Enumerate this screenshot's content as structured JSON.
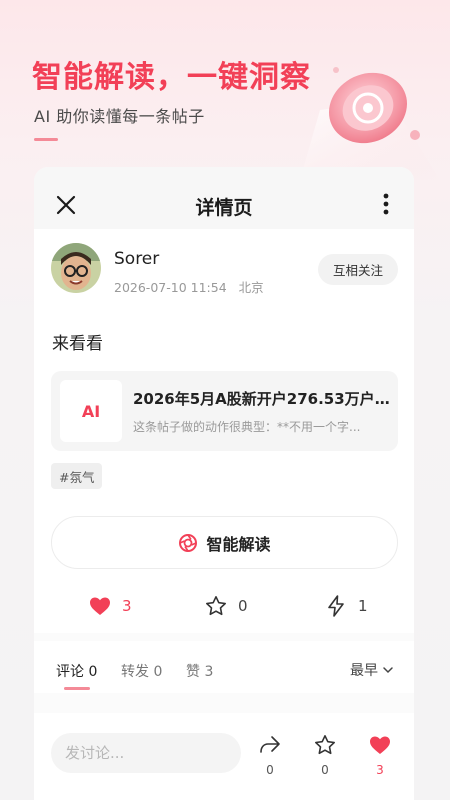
{
  "hero": {
    "title": "智能解读，一键洞察",
    "subtitle": "AI 助你读懂每一条帖子"
  },
  "header": {
    "title": "详情页"
  },
  "post": {
    "author": {
      "name": "Sorer",
      "timestamp": "2026-07-10 11:54",
      "location": "北京"
    },
    "follow_label": "互相关注",
    "text": "来看看",
    "link": {
      "thumb_label": "AI",
      "title": "2026年5月A股新开户276.53万户...",
      "desc": "这条帖子做的动作很典型：**不用一个字..."
    },
    "tag": "#氛气",
    "ai_read_label": "智能解读",
    "stats": {
      "likes": "3",
      "favorites": "0",
      "shares": "1"
    }
  },
  "tabs": {
    "items": [
      {
        "label": "评论 0"
      },
      {
        "label": "转发 0"
      },
      {
        "label": "赞 3"
      }
    ],
    "sort_label": "最早"
  },
  "bottom": {
    "placeholder": "发讨论...",
    "forward_count": "0",
    "favorite_count": "0",
    "like_count": "3"
  },
  "colors": {
    "accent": "#f24057",
    "accent_light": "#f48a97"
  }
}
